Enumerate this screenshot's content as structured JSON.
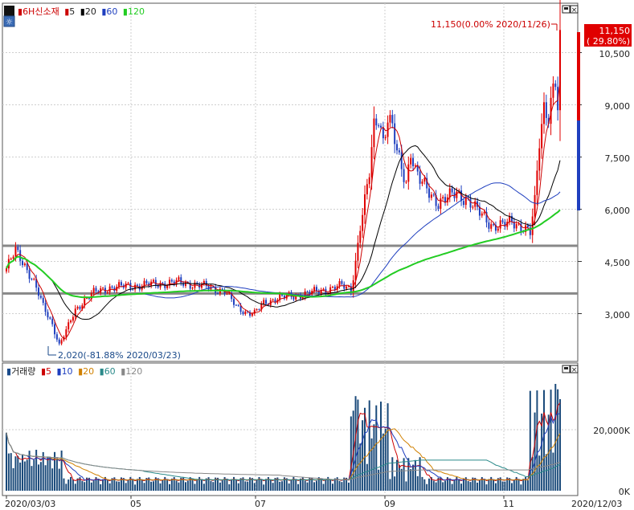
{
  "price_pane": {
    "legend": [
      {
        "label": "6H신소재",
        "color": "#cc0000"
      },
      {
        "label": "5",
        "color": "#cc0000"
      },
      {
        "label": "20",
        "color": "#000000"
      },
      {
        "label": "60",
        "color": "#1f3fbf"
      },
      {
        "label": "120",
        "color": "#22cc22"
      }
    ],
    "y_ticks": [
      "10,500",
      "9,000",
      "7,500",
      "6,000",
      "4,500",
      "3,000"
    ],
    "last_price_badge": {
      "price": "11,150",
      "change": "( 29.80%)",
      "color": "#e00000"
    },
    "high_annotation": "11,150(0.00% 2020/11/26)",
    "low_annotation": "2,020(-81.88% 2020/03/23)",
    "pane_buttons": [
      "□",
      "×"
    ]
  },
  "volume_pane": {
    "legend": [
      {
        "label": "거래량",
        "color": "#1a4a8a"
      },
      {
        "label": "5",
        "color": "#cc0000"
      },
      {
        "label": "10",
        "color": "#1f3fbf"
      },
      {
        "label": "20",
        "color": "#d08000"
      },
      {
        "label": "60",
        "color": "#2a8a8a"
      },
      {
        "label": "120",
        "color": "#888888"
      }
    ],
    "y_ticks": [
      "20,000K",
      "0K"
    ],
    "pane_buttons": [
      "□",
      "×"
    ]
  },
  "x_axis": {
    "labels": [
      "2020/03/03",
      "05",
      "07",
      "09",
      "11",
      "2020/12/03"
    ]
  },
  "chart_data": [
    {
      "type": "candlestick",
      "title": "6H신소재",
      "x_range": [
        "2020/03/03",
        "2020/12/03"
      ],
      "ylim": [
        1500,
        12000
      ],
      "y_ticks": [
        3000,
        4500,
        6000,
        7500,
        9000,
        10500
      ],
      "grid": true,
      "legend_placement": "top-left",
      "series": [
        {
          "name": "5",
          "type": "line",
          "color": "#cc0000"
        },
        {
          "name": "20",
          "type": "line",
          "color": "#000000"
        },
        {
          "name": "60",
          "type": "line",
          "color": "#1f3fbf"
        },
        {
          "name": "120",
          "type": "line",
          "color": "#22cc22"
        }
      ],
      "horizontal_levels": [
        4950,
        3580
      ],
      "last_price": 11150,
      "last_change_pct": 29.8,
      "high": {
        "value": 11150,
        "date": "2020/11/26"
      },
      "low": {
        "value": 2020,
        "date": "2020/03/23"
      }
    },
    {
      "type": "bar",
      "title": "거래량",
      "ylim": [
        0,
        36000
      ],
      "y_ticks": [
        0,
        20000
      ],
      "unit": "K",
      "series": [
        {
          "name": "거래량",
          "color": "#1a4a8a"
        },
        {
          "name": "5",
          "color": "#cc0000"
        },
        {
          "name": "10",
          "color": "#1f3fbf"
        },
        {
          "name": "20",
          "color": "#d08000"
        },
        {
          "name": "60",
          "color": "#2a8a8a"
        },
        {
          "name": "120",
          "color": "#888888"
        }
      ]
    }
  ]
}
